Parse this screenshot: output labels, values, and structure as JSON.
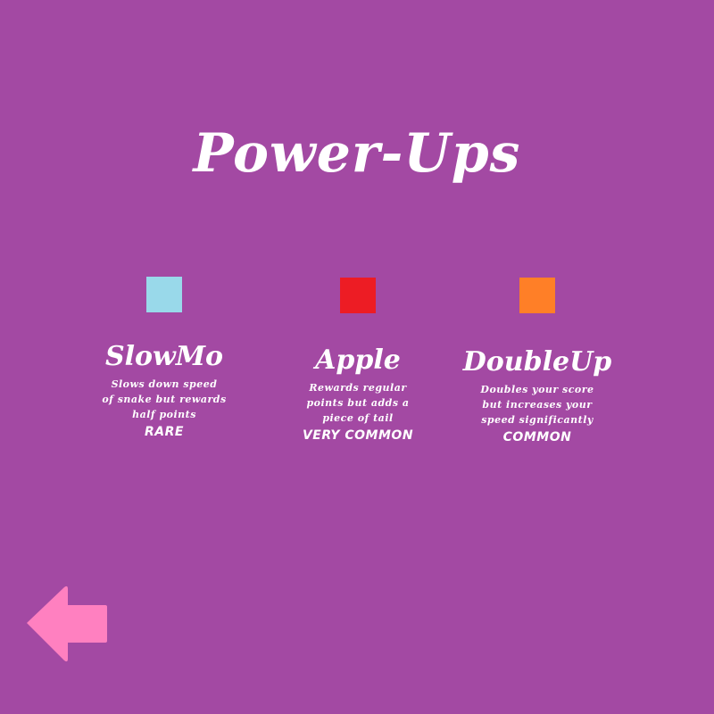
{
  "screen": {
    "title": "Power-Ups",
    "background_color": "#a349a3"
  },
  "powerups": [
    {
      "name": "SlowMo",
      "color": "#99d9ea",
      "description": [
        "Slows down speed",
        "of snake but rewards",
        "half points"
      ],
      "rarity": "RARE"
    },
    {
      "name": "Apple",
      "color": "#ed1c24",
      "description": [
        "Rewards regular",
        "points but adds a",
        "piece of tail"
      ],
      "rarity": "VERY COMMON"
    },
    {
      "name": "DoubleUp",
      "color": "#ff7f27",
      "description": [
        "Doubles your score",
        "but increases your",
        "speed significantly"
      ],
      "rarity": "COMMON"
    }
  ],
  "back_button": {
    "icon": "back-arrow-icon",
    "color": "#ff80c0"
  }
}
